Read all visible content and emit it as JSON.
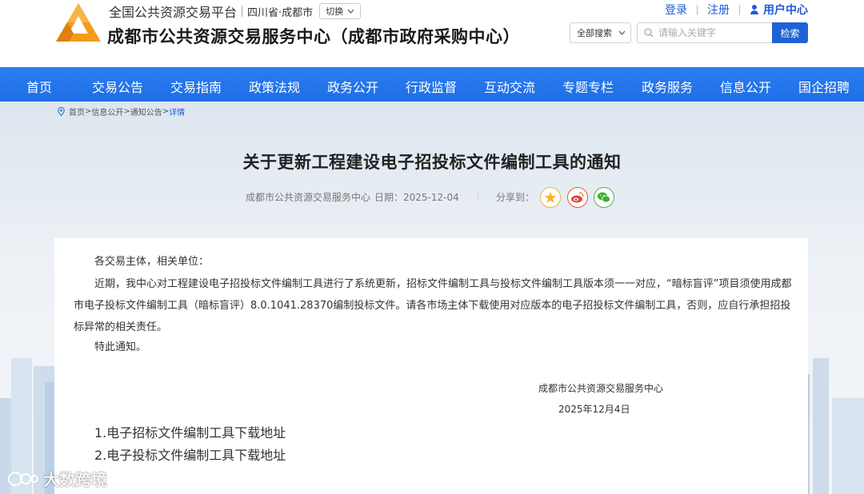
{
  "header": {
    "site_name": "全国公共资源交易平台",
    "region": "四川省·成都市",
    "switch_label": "切换",
    "title": "成都市公共资源交易服务中心（成都市政府采购中心）",
    "links": {
      "login": "登录",
      "register": "注册",
      "user_center": "用户中心"
    },
    "search": {
      "scope": "全部搜索",
      "placeholder": "请输入关键字",
      "button": "检索"
    }
  },
  "nav": {
    "items": [
      "首页",
      "交易公告",
      "交易指南",
      "政策法规",
      "政务公开",
      "行政监督",
      "互动交流",
      "专题专栏",
      "政务服务",
      "信息公开",
      "国企招聘"
    ]
  },
  "breadcrumb": {
    "home": "首页",
    "sep": ">",
    "l1": "信息公开",
    "l2": "通知公告",
    "current": "详情"
  },
  "article": {
    "title": "关于更新工程建设电子招投标文件编制工具的通知",
    "source": "成都市公共资源交易服务中心",
    "date": "日期：2025-12-04",
    "share_label": "分享到：",
    "salutation": "各交易主体，相关单位：",
    "body": "近期，我中心对工程建设电子招投标文件编制工具进行了系统更新，招标文件编制工具与投标文件编制工具版本须一一对应，“暗标盲评”项目须使用成都市电子投标文件编制工具（暗标盲评）8.0.1041.28370编制投标文件。请各市场主体下载使用对应版本的电子招投标文件编制工具，否则，应自行承担招投标异常的相关责任。",
    "closing": "特此通知。",
    "signature_org": "成都市公共资源交易服务中心",
    "signature_date": "2025年12月4日",
    "links": [
      "1.电子招标文件编制工具下载地址",
      "2.电子投标文件编制工具下载地址"
    ]
  },
  "watermark": "大数跨境",
  "colors": {
    "primary": "#1e63d6",
    "nav": "#2a7df0",
    "logo_orange": "#f5a623"
  }
}
